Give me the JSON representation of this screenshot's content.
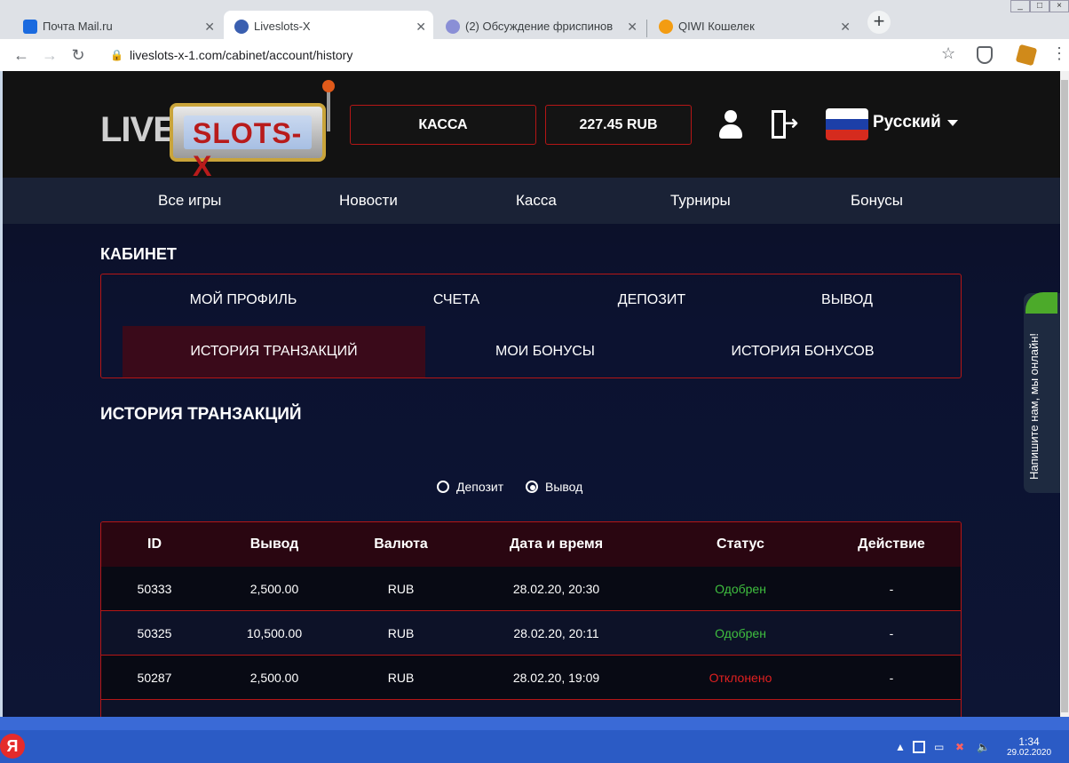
{
  "browser": {
    "tabs": [
      {
        "label": "Почта Mail.ru"
      },
      {
        "label": "Liveslots-X"
      },
      {
        "label": "(2) Обсуждение фриспинов"
      },
      {
        "label": "QIWI Кошелек"
      }
    ],
    "url": "liveslots-x-1.com/cabinet/account/history"
  },
  "site": {
    "logo_live": "LIVE",
    "logo_slots": "SLOTS-X",
    "kassa": "КАССА",
    "balance": "227.45 RUB",
    "language": "Русский"
  },
  "nav": [
    "Все игры",
    "Новости",
    "Касса",
    "Турниры",
    "Бонусы"
  ],
  "cabinet": {
    "title": "КАБИНЕТ",
    "menu_row1": [
      "МОЙ ПРОФИЛЬ",
      "СЧЕТА",
      "ДЕПОЗИТ",
      "ВЫВОД"
    ],
    "menu_row2": [
      "ИСТОРИЯ ТРАНЗАКЦИЙ",
      "МОИ БОНУСЫ",
      "ИСТОРИЯ БОНУСОВ"
    ]
  },
  "history": {
    "title": "ИСТОРИЯ ТРАНЗАКЦИЙ",
    "radio_deposit": "Депозит",
    "radio_withdraw": "Вывод",
    "columns": [
      "ID",
      "Вывод",
      "Валюта",
      "Дата и время",
      "Статус",
      "Действие"
    ],
    "rows": [
      [
        "50333",
        "2,500.00",
        "RUB",
        "28.02.20, 20:30",
        "Одобрен",
        "-"
      ],
      [
        "50325",
        "10,500.00",
        "RUB",
        "28.02.20, 20:11",
        "Одобрен",
        "-"
      ],
      [
        "50287",
        "2,500.00",
        "RUB",
        "28.02.20, 19:09",
        "Отклонено",
        "-"
      ]
    ]
  },
  "chat": "Напишите нам, мы онлайн!",
  "taskbar": {
    "start": "Я",
    "time": "1:34",
    "date": "29.02.2020"
  }
}
